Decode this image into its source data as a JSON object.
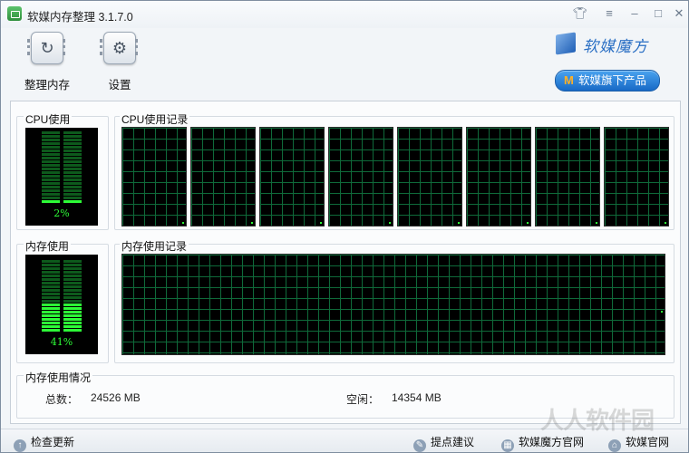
{
  "window": {
    "title": "软媒内存整理 3.1.7.0"
  },
  "titlebar": {
    "skin_icon": "shirt-icon",
    "menu_icon": "menu-icon",
    "minimize_icon": "minimize-icon",
    "maximize_icon": "maximize-icon",
    "close_icon": "close-icon"
  },
  "toolbar": {
    "clean_label": "整理内存",
    "settings_label": "设置"
  },
  "brand": {
    "name": "软媒魔方",
    "button_label": "软媒旗下产品",
    "button_mark": "M"
  },
  "cpu": {
    "title": "CPU使用",
    "history_title": "CPU使用记录",
    "usage_pct": "2%",
    "usage_value": 0.02,
    "core_count": 8
  },
  "memory": {
    "title": "内存使用",
    "history_title": "内存使用记录",
    "usage_pct": "41%",
    "usage_value": 0.41
  },
  "memory_info": {
    "title": "内存使用情况",
    "total_label": "总数：",
    "total_value": "24526 MB",
    "free_label": "空闲：",
    "free_value": "14354 MB"
  },
  "statusbar": {
    "check_update": "检查更新",
    "feedback": "提点建议",
    "website": "软媒魔方官网",
    "official_site": "软媒官网"
  },
  "colors": {
    "meter_green": "#2dfc37",
    "grid_green": "#0f6a3a",
    "accent_blue": "#1769c6"
  }
}
